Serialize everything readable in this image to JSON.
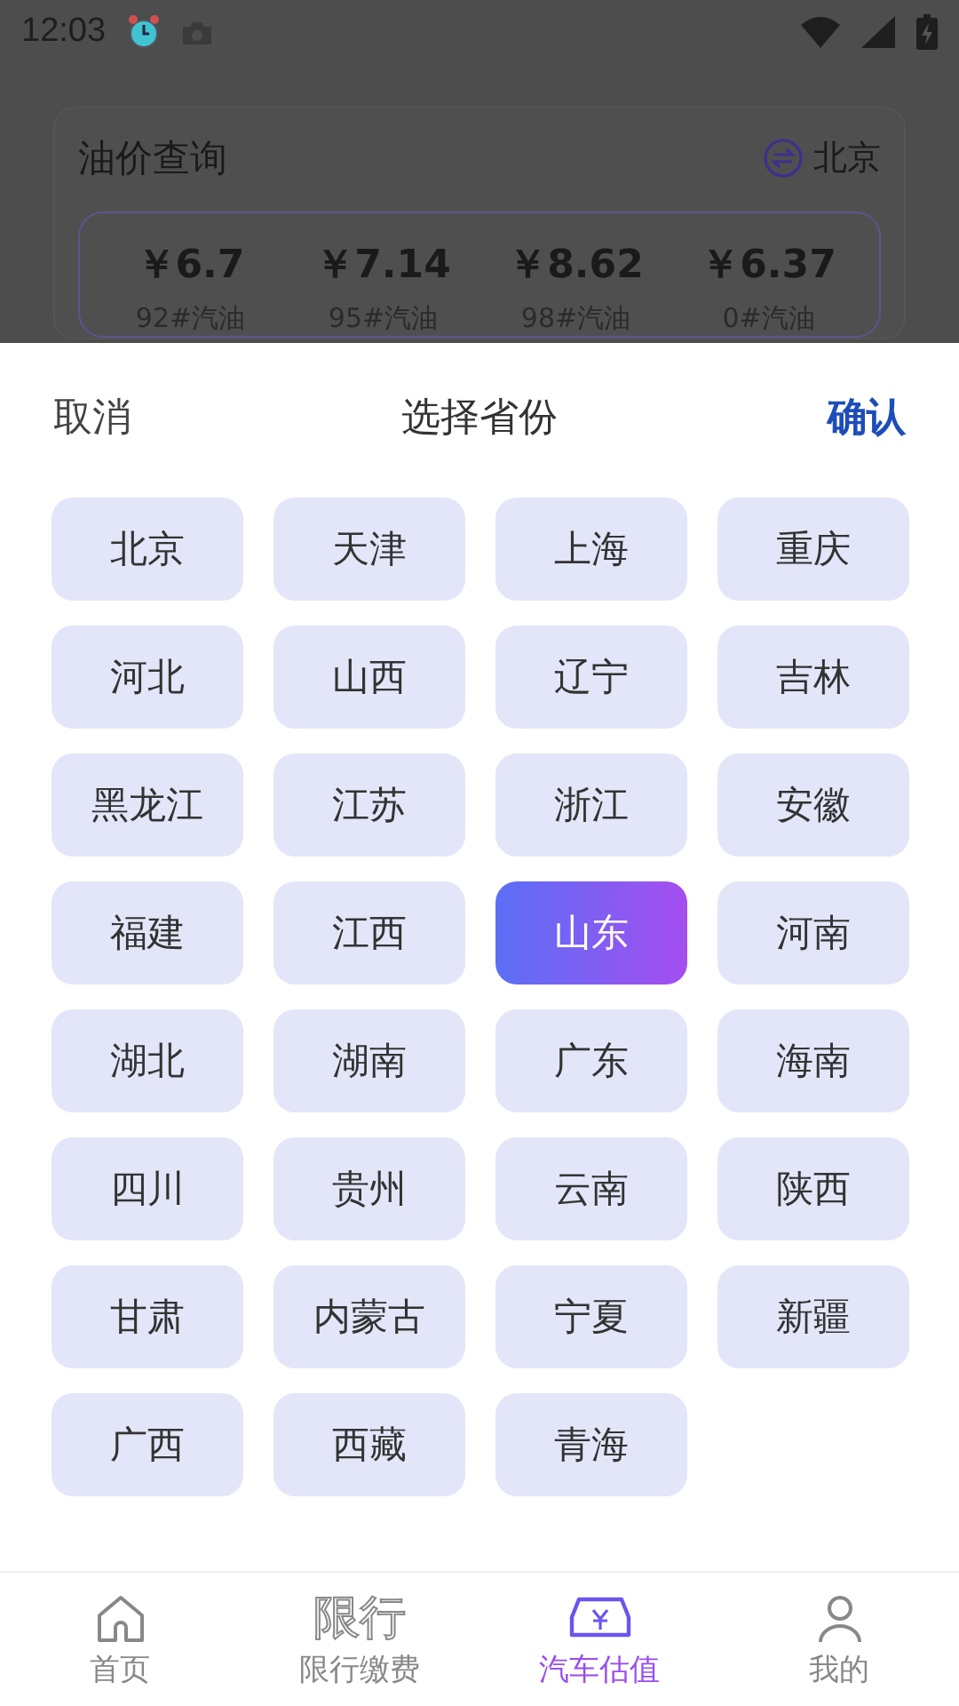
{
  "status_bar": {
    "time": "12:03"
  },
  "card": {
    "title": "油价查询",
    "city": "北京",
    "prices": [
      {
        "price": "￥6.7",
        "label": "92#汽油"
      },
      {
        "price": "￥7.14",
        "label": "95#汽油"
      },
      {
        "price": "￥8.62",
        "label": "98#汽油"
      },
      {
        "price": "￥6.37",
        "label": "0#汽油"
      }
    ]
  },
  "sheet": {
    "cancel": "取消",
    "title": "选择省份",
    "confirm": "确认",
    "provinces": [
      {
        "name": "北京",
        "selected": false
      },
      {
        "name": "天津",
        "selected": false
      },
      {
        "name": "上海",
        "selected": false
      },
      {
        "name": "重庆",
        "selected": false
      },
      {
        "name": "河北",
        "selected": false
      },
      {
        "name": "山西",
        "selected": false
      },
      {
        "name": "辽宁",
        "selected": false
      },
      {
        "name": "吉林",
        "selected": false
      },
      {
        "name": "黑龙江",
        "selected": false
      },
      {
        "name": "江苏",
        "selected": false
      },
      {
        "name": "浙江",
        "selected": false
      },
      {
        "name": "安徽",
        "selected": false
      },
      {
        "name": "福建",
        "selected": false
      },
      {
        "name": "江西",
        "selected": false
      },
      {
        "name": "山东",
        "selected": true
      },
      {
        "name": "河南",
        "selected": false
      },
      {
        "name": "湖北",
        "selected": false
      },
      {
        "name": "湖南",
        "selected": false
      },
      {
        "name": "广东",
        "selected": false
      },
      {
        "name": "海南",
        "selected": false
      },
      {
        "name": "四川",
        "selected": false
      },
      {
        "name": "贵州",
        "selected": false
      },
      {
        "name": "云南",
        "selected": false
      },
      {
        "name": "陕西",
        "selected": false
      },
      {
        "name": "甘肃",
        "selected": false
      },
      {
        "name": "内蒙古",
        "selected": false
      },
      {
        "name": "宁夏",
        "selected": false
      },
      {
        "name": "新疆",
        "selected": false
      },
      {
        "name": "广西",
        "selected": false
      },
      {
        "name": "西藏",
        "selected": false
      },
      {
        "name": "青海",
        "selected": false
      }
    ]
  },
  "nav": [
    {
      "kind": "home",
      "label": "首页",
      "selected": false
    },
    {
      "kind": "text",
      "icon_text": "限行",
      "label": "限行缴费",
      "selected": false
    },
    {
      "kind": "car",
      "label": "汽车估值",
      "selected": true
    },
    {
      "kind": "person",
      "label": "我的",
      "selected": false
    }
  ]
}
